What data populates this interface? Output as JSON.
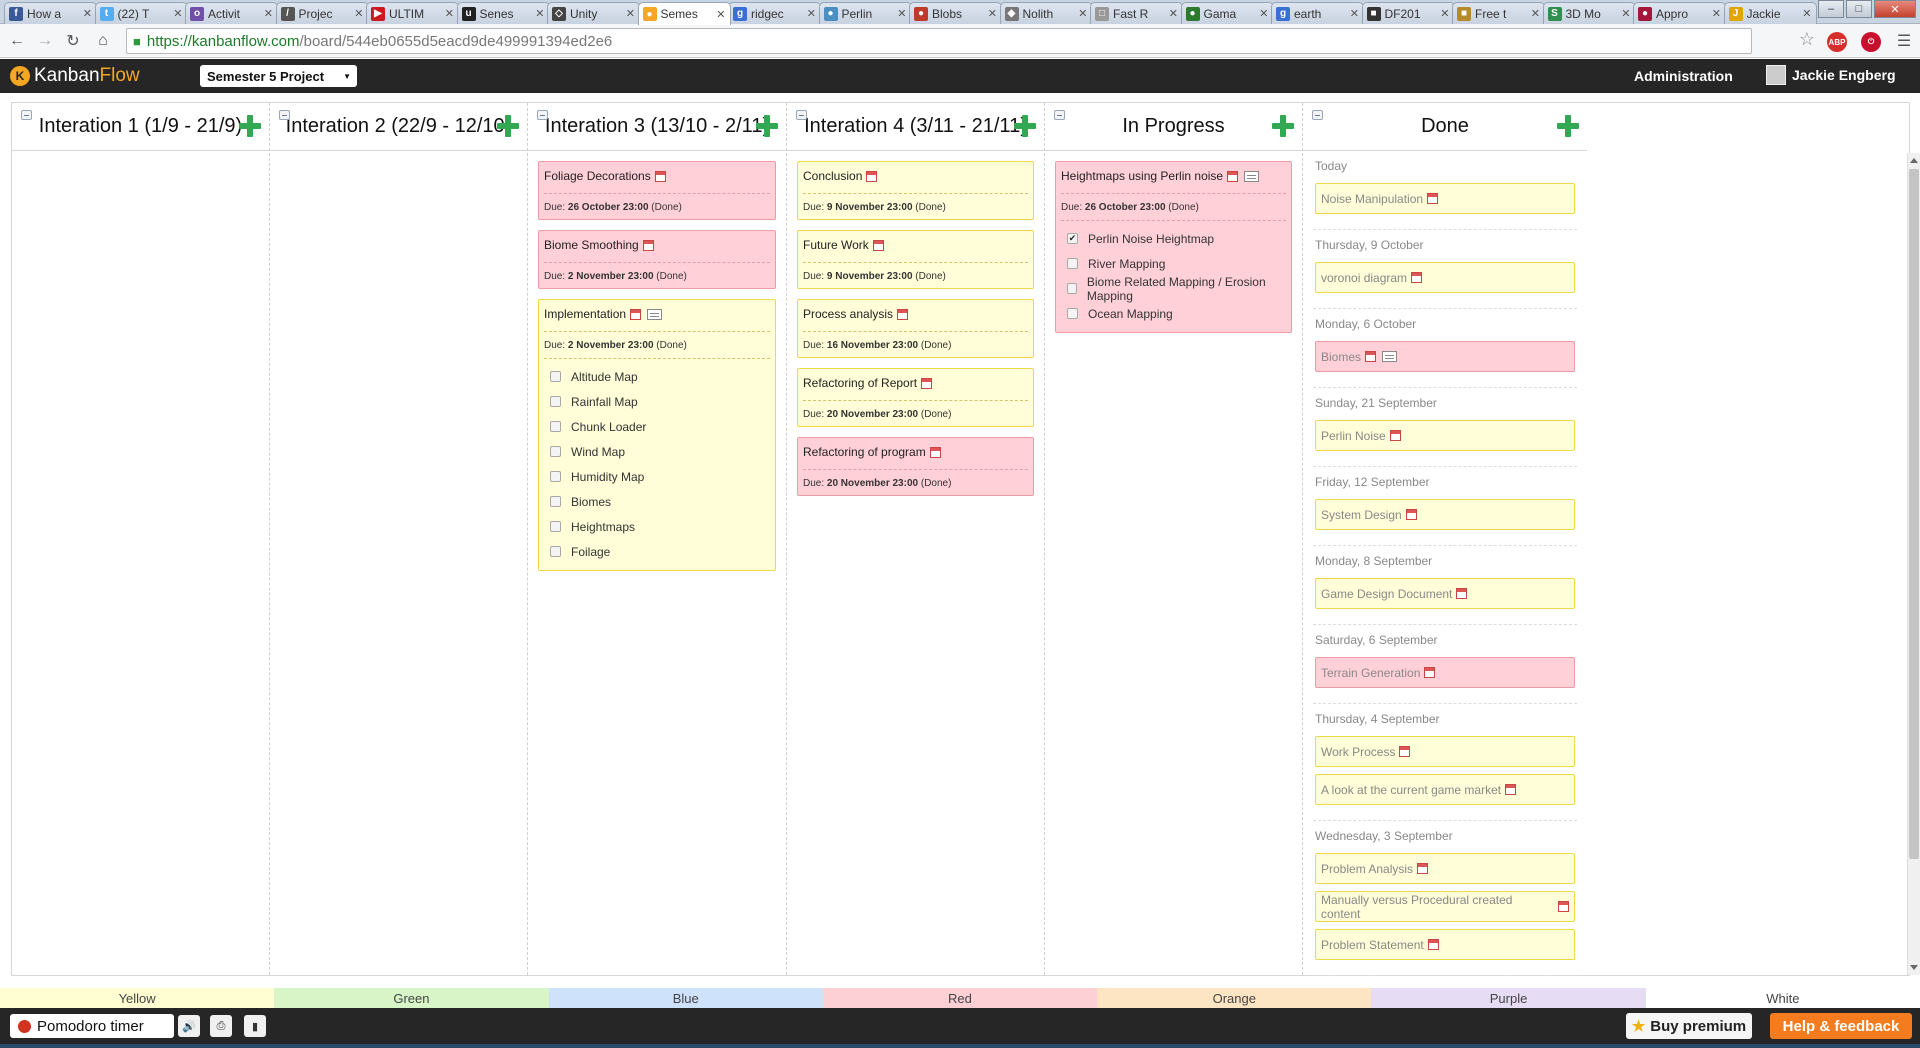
{
  "browser": {
    "tabs": [
      {
        "label": "How a",
        "color": "#3b5998",
        "glyph": "f"
      },
      {
        "label": "(22) T",
        "color": "#55acee",
        "glyph": "t"
      },
      {
        "label": "Activit",
        "color": "#6f4fa8",
        "glyph": "o"
      },
      {
        "label": "Projec",
        "color": "#555555",
        "glyph": "/"
      },
      {
        "label": "ULTIM",
        "color": "#cc181e",
        "glyph": "▶"
      },
      {
        "label": "Senes",
        "color": "#222222",
        "glyph": "u"
      },
      {
        "label": "Unity",
        "color": "#444444",
        "glyph": "◇"
      },
      {
        "label": "Semes",
        "color": "#f5a623",
        "glyph": "●",
        "active": true
      },
      {
        "label": "ridgec",
        "color": "#3b6fd4",
        "glyph": "g"
      },
      {
        "label": "Perlin",
        "color": "#4a8fc2",
        "glyph": "●"
      },
      {
        "label": "Blobs",
        "color": "#c0392b",
        "glyph": "●"
      },
      {
        "label": "Nolith",
        "color": "#777777",
        "glyph": "◆"
      },
      {
        "label": "Fast R",
        "color": "#999999",
        "glyph": "□"
      },
      {
        "label": "Gama",
        "color": "#2c7a2c",
        "glyph": "●"
      },
      {
        "label": "earth",
        "color": "#3b6fd4",
        "glyph": "g"
      },
      {
        "label": "DF201",
        "color": "#333333",
        "glyph": "■"
      },
      {
        "label": "Free t",
        "color": "#b58b2a",
        "glyph": "■"
      },
      {
        "label": "3D Mo",
        "color": "#2f8f4e",
        "glyph": "S"
      },
      {
        "label": "Appro",
        "color": "#a3183a",
        "glyph": "●"
      },
      {
        "label": "Jackie",
        "color": "#e2a400",
        "glyph": "J"
      }
    ],
    "url_host": "https://kanbanflow.com",
    "url_path": "/board/544eb0655d5eacd9de499991394ed2e6"
  },
  "app": {
    "logo_kanban": "Kanban",
    "logo_flow": "Flow",
    "board_name": "Semester 5 Project",
    "admin_label": "Administration",
    "user_name": "Jackie Engberg"
  },
  "columns": [
    {
      "title": "Interation 1 (1/9 - 21/9)",
      "tasks": []
    },
    {
      "title": "Interation 2 (22/9 - 12/10)",
      "tasks": []
    },
    {
      "title": "Interation 3 (13/10 - 2/11)",
      "tasks": [
        {
          "title": "Foliage Decorations",
          "color": "r",
          "due_prefix": "Due:",
          "due_date": "26 October 23:00",
          "due_status": "(Done)"
        },
        {
          "title": "Biome Smoothing",
          "color": "r",
          "due_prefix": "Due:",
          "due_date": "2 November 23:00",
          "due_status": "(Done)"
        },
        {
          "title": "Implementation",
          "color": "y",
          "desc": true,
          "due_prefix": "Due:",
          "due_date": "2 November 23:00",
          "due_status": "(Done)",
          "subtasks": [
            {
              "label": "Altitude Map",
              "checked": false
            },
            {
              "label": "Rainfall Map",
              "checked": false
            },
            {
              "label": "Chunk Loader",
              "checked": false
            },
            {
              "label": "Wind Map",
              "checked": false
            },
            {
              "label": "Humidity Map",
              "checked": false
            },
            {
              "label": "Biomes",
              "checked": false
            },
            {
              "label": "Heightmaps",
              "checked": false
            },
            {
              "label": "Foilage",
              "checked": false
            }
          ]
        }
      ]
    },
    {
      "title": "Interation 4 (3/11 - 21/11)",
      "tasks": [
        {
          "title": "Conclusion",
          "color": "y",
          "due_prefix": "Due:",
          "due_date": "9 November 23:00",
          "due_status": "(Done)"
        },
        {
          "title": "Future Work",
          "color": "y",
          "due_prefix": "Due:",
          "due_date": "9 November 23:00",
          "due_status": "(Done)"
        },
        {
          "title": "Process analysis",
          "color": "y",
          "due_prefix": "Due:",
          "due_date": "16 November 23:00",
          "due_status": "(Done)"
        },
        {
          "title": "Refactoring of Report",
          "color": "y",
          "due_prefix": "Due:",
          "due_date": "20 November 23:00",
          "due_status": "(Done)"
        },
        {
          "title": "Refactoring of program",
          "color": "r",
          "due_prefix": "Due:",
          "due_date": "20 November 23:00",
          "due_status": "(Done)"
        }
      ]
    },
    {
      "title": "In Progress",
      "tasks": [
        {
          "title": "Heightmaps using Perlin noise",
          "color": "r",
          "desc": true,
          "due_prefix": "Due:",
          "due_date": "26 October 23:00",
          "due_status": "(Done)",
          "subtasks": [
            {
              "label": "Perlin Noise Heightmap",
              "checked": true
            },
            {
              "label": "River Mapping",
              "checked": false
            },
            {
              "label": "Biome Related Mapping / Erosion Mapping",
              "checked": false
            },
            {
              "label": "Ocean Mapping",
              "checked": false
            }
          ]
        }
      ]
    },
    {
      "title": "Done",
      "done_groups": [
        {
          "date": "Today",
          "tasks": [
            {
              "title": "Noise Manipulation",
              "color": "y"
            }
          ]
        },
        {
          "date": "Thursday, 9 October",
          "tasks": [
            {
              "title": "voronoi diagram",
              "color": "y"
            }
          ]
        },
        {
          "date": "Monday, 6 October",
          "tasks": [
            {
              "title": "Biomes",
              "color": "r",
              "desc": true
            }
          ]
        },
        {
          "date": "Sunday, 21 September",
          "tasks": [
            {
              "title": "Perlin Noise",
              "color": "y"
            }
          ]
        },
        {
          "date": "Friday, 12 September",
          "tasks": [
            {
              "title": "System Design",
              "color": "y"
            }
          ]
        },
        {
          "date": "Monday, 8 September",
          "tasks": [
            {
              "title": "Game Design Document",
              "color": "y"
            }
          ]
        },
        {
          "date": "Saturday, 6 September",
          "tasks": [
            {
              "title": "Terrain Generation",
              "color": "r"
            }
          ]
        },
        {
          "date": "Thursday, 4 September",
          "tasks": [
            {
              "title": "Work Process",
              "color": "y"
            },
            {
              "title": "A look at the current game market",
              "color": "y"
            }
          ]
        },
        {
          "date": "Wednesday, 3 September",
          "tasks": [
            {
              "title": "Problem Analysis",
              "color": "y"
            },
            {
              "title": "Manually versus Procedural created content",
              "color": "y"
            },
            {
              "title": "Problem Statement",
              "color": "y"
            }
          ]
        }
      ]
    }
  ],
  "colors_legend": [
    {
      "label": "Yellow",
      "color": "#fffed2"
    },
    {
      "label": "Green",
      "color": "#d8f5c8"
    },
    {
      "label": "Blue",
      "color": "#cfe2fb"
    },
    {
      "label": "Red",
      "color": "#fdd0d6"
    },
    {
      "label": "Orange",
      "color": "#fde4c3"
    },
    {
      "label": "Purple",
      "color": "#e6dcf4"
    },
    {
      "label": "White",
      "color": "#ffffff"
    }
  ],
  "footer": {
    "pomodoro_label": "Pomodoro timer",
    "buy_premium_label": "Buy premium",
    "help_label": "Help & feedback"
  }
}
